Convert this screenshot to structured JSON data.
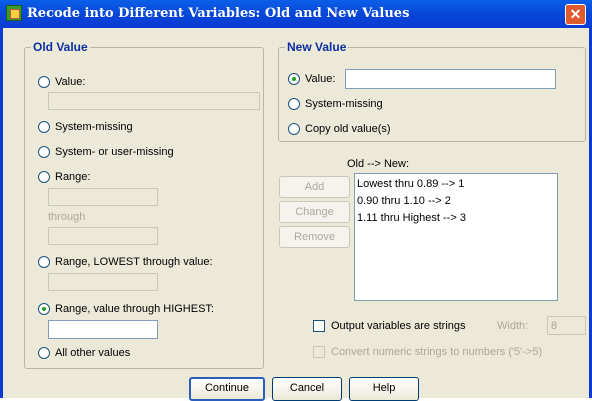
{
  "window": {
    "title": "Recode into Different Variables: Old and New Values",
    "close_glyph": "✕"
  },
  "old_value": {
    "legend": "Old Value",
    "value_label": "Value:",
    "value_text": "",
    "system_missing_label": "System-missing",
    "system_or_user_missing_label": "System- or user-missing",
    "range_label": "Range:",
    "range_from": "",
    "through_label": "through",
    "range_to": "",
    "range_lowest_label": "Range, LOWEST through value:",
    "range_lowest_value": "",
    "range_highest_label": "Range, value through HIGHEST:",
    "range_highest_value": "",
    "all_other_label": "All other values",
    "selected": "range_highest"
  },
  "new_value": {
    "legend": "New Value",
    "value_label": "Value:",
    "value_text": "",
    "system_missing_label": "System-missing",
    "copy_old_label": "Copy old value(s)",
    "selected": "value"
  },
  "mapping": {
    "label": "Old --> New:",
    "items": [
      "Lowest thru 0.89 --> 1",
      "0.90 thru 1.10 --> 2",
      "1.11 thru Highest --> 3"
    ],
    "add_label": "Add",
    "change_label": "Change",
    "remove_label": "Remove"
  },
  "options": {
    "output_strings_label": "Output variables are strings",
    "width_label": "Width:",
    "width_value": "8",
    "convert_label": "Convert numeric strings to numbers ('5'->5)"
  },
  "footer": {
    "continue_label": "Continue",
    "cancel_label": "Cancel",
    "help_label": "Help"
  },
  "colors": {
    "title_bar": "#0a3bd4",
    "legend_text": "#0b2fa3",
    "radio_dot": "#21a121"
  }
}
